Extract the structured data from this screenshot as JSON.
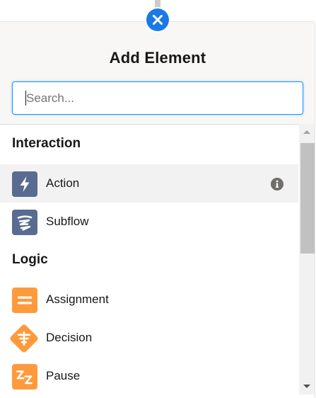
{
  "panel": {
    "title": "Add Element",
    "close_icon": "close-icon"
  },
  "search": {
    "placeholder": "Search...",
    "value": ""
  },
  "sections": [
    {
      "heading": "Interaction",
      "items": [
        {
          "label": "Action",
          "icon": "lightning-bolt-icon",
          "color": "#5a6b91",
          "selected": true,
          "info_icon": "info-icon"
        },
        {
          "label": "Subflow",
          "icon": "subflow-icon",
          "color": "#5a6b91",
          "selected": false
        }
      ]
    },
    {
      "heading": "Logic",
      "items": [
        {
          "label": "Assignment",
          "icon": "assignment-icon",
          "color": "#ff9a3c",
          "selected": false
        },
        {
          "label": "Decision",
          "icon": "decision-icon",
          "color": "#ff9a3c",
          "selected": false
        },
        {
          "label": "Pause",
          "icon": "pause-zz-icon",
          "color": "#ff9a3c",
          "selected": false
        }
      ]
    }
  ],
  "colors": {
    "accent": "#1b79e6",
    "focus_border": "#1b96ff",
    "header_bg": "#f8f7f5",
    "selected_row": "#f3f2f2",
    "interaction_icon": "#5a6b91",
    "logic_icon": "#ff9a3c"
  }
}
